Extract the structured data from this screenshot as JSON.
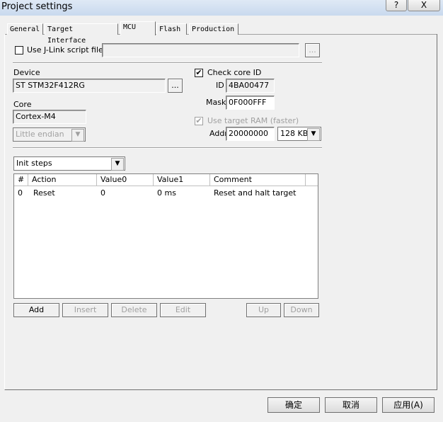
{
  "window": {
    "title": "Project settings",
    "help_label": "?",
    "close_label": "X"
  },
  "tabs": [
    {
      "label": "General"
    },
    {
      "label": "Target Interface"
    },
    {
      "label": "MCU"
    },
    {
      "label": "Flash"
    },
    {
      "label": "Production"
    }
  ],
  "script": {
    "label": "Use J-Link script file",
    "checked": false,
    "path_value": "",
    "browse_label": "..."
  },
  "device": {
    "label": "Device",
    "value": "ST STM32F412RG",
    "browse_label": "...",
    "core_label": "Core",
    "core_value": "Cortex-M4",
    "endian_value": "Little endian"
  },
  "core_id": {
    "check_label": "Check core ID",
    "checked": true,
    "id_label": "ID",
    "id_value": "4BA00477",
    "mask_label": "Mask",
    "mask_value": "0F000FFF"
  },
  "ram": {
    "label": "Use target RAM (faster)",
    "checked": true,
    "addr_label": "Addr",
    "addr_value": "20000000",
    "size_value": "128 KB"
  },
  "steps": {
    "selected": "Init steps",
    "columns": [
      "#",
      "Action",
      "Value0",
      "Value1",
      "Comment"
    ],
    "rows": [
      {
        "num": "0",
        "action": "Reset",
        "value0": "0",
        "value1": "0 ms",
        "comment": "Reset and halt target"
      }
    ],
    "buttons": {
      "add": "Add",
      "insert": "Insert",
      "delete": "Delete",
      "edit": "Edit",
      "up": "Up",
      "down": "Down"
    }
  },
  "dialog_buttons": {
    "ok": "确定",
    "cancel": "取消",
    "apply": "应用(A)"
  }
}
